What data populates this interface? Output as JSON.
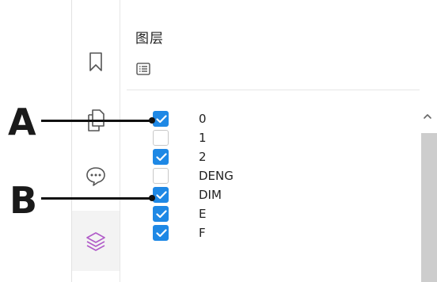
{
  "panel": {
    "title": "图层",
    "menu_icon": "list-icon"
  },
  "rail": {
    "items": [
      {
        "name": "bookmark",
        "icon": "bookmark-icon",
        "active": false
      },
      {
        "name": "pages",
        "icon": "pages-icon",
        "active": false
      },
      {
        "name": "comments",
        "icon": "comment-icon",
        "active": false
      },
      {
        "name": "layers",
        "icon": "layers-icon",
        "active": true
      }
    ]
  },
  "layers": [
    {
      "label": "0",
      "checked": true
    },
    {
      "label": "1",
      "checked": false
    },
    {
      "label": "2",
      "checked": true
    },
    {
      "label": "DENG",
      "checked": false
    },
    {
      "label": "DIM",
      "checked": true
    },
    {
      "label": "E",
      "checked": true
    },
    {
      "label": "F",
      "checked": true
    }
  ],
  "callouts": {
    "a": "A",
    "b": "B"
  },
  "colors": {
    "checkbox_checked": "#1e88e5",
    "layers_icon_accent": "#b05ac8",
    "scroll_thumb": "#cdcdcd"
  }
}
